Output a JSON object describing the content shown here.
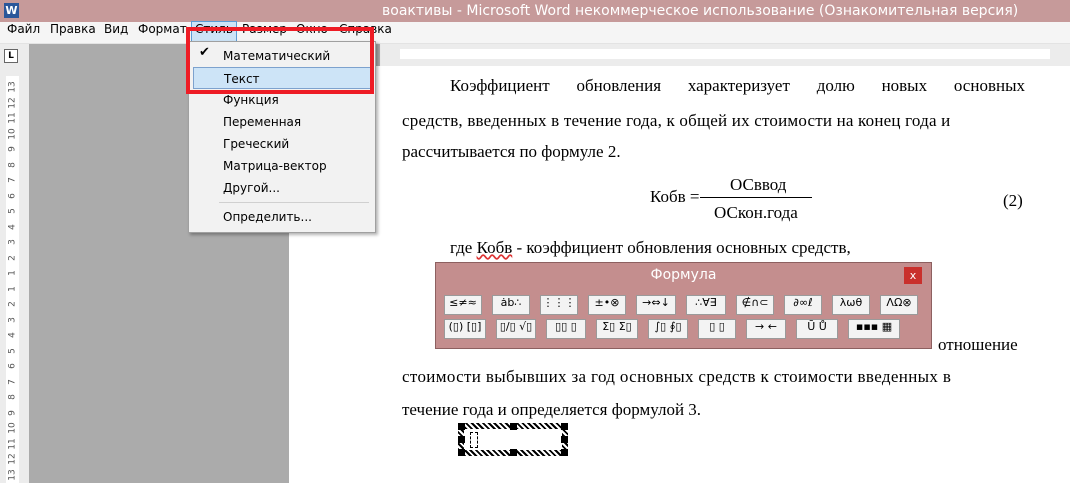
{
  "window": {
    "app_icon": "W",
    "title": "воактивы - Microsoft Word некоммерческое использование (Ознакомительная версия)"
  },
  "menubar": {
    "items": [
      {
        "label": "Файл"
      },
      {
        "label": "Правка"
      },
      {
        "label": "Вид"
      },
      {
        "label": "Формат"
      },
      {
        "label": "Стиль",
        "active": true
      },
      {
        "label": "Размер"
      },
      {
        "label": "Окно"
      },
      {
        "label": "Справка"
      }
    ]
  },
  "ruler": {
    "tab_marker": "L",
    "vertical_numbers": [
      "13",
      "12",
      "11",
      "10",
      "9",
      "8",
      "7",
      "6",
      "5",
      "4",
      "3",
      "2",
      "1",
      "1",
      "2",
      "3",
      "4",
      "5",
      "6",
      "7",
      "8",
      "9",
      "10",
      "11",
      "12",
      "13"
    ]
  },
  "style_menu": {
    "items": [
      {
        "label": "Математический",
        "checked": true
      },
      {
        "label": "Текст",
        "highlighted": true
      },
      {
        "label": "Функция"
      },
      {
        "label": "Переменная"
      },
      {
        "label": "Греческий"
      },
      {
        "label": "Матрица-вектор"
      },
      {
        "label": "Другой..."
      },
      {
        "label": "Определить..."
      }
    ],
    "check_icon": "check-icon"
  },
  "document": {
    "para1_line1_words": [
      "Коэффициент",
      "обновления",
      "характеризует",
      "долю",
      "новых",
      "основных"
    ],
    "para1_line2": "средств, введенных в течение года, к общей их стоимости на конец года и",
    "para1_line3": "рассчитывается по формуле 2.",
    "formula": {
      "lhs": "Кобв =",
      "numerator": "ОСввод",
      "denominator": "ОСкон.года",
      "number": "(2)"
    },
    "where_line_prefix": "где ",
    "where_word": "Кобв",
    "where_line_suffix": " - коэффициент обновления основных средств,",
    "para2_line1_partial": "отношение",
    "para2_line2": "стоимости выбывших за год основных средств к стоимости введенных в",
    "para2_line3": "течение года и определяется формулой 3."
  },
  "formula_toolbar": {
    "title": "Формула",
    "close_label": "x",
    "row1": [
      "≤≠≈",
      "ȧb∴",
      "⋮⋮⋮",
      "±•⊗",
      "→⇔↓",
      "∴∀∃",
      "∉∩⊂",
      "∂∞ℓ",
      "λωθ",
      "ΛΩ⊗"
    ],
    "row2": [
      "(▯) [▯]",
      "▯/▯ √▯",
      "▯▯ ▯",
      "Σ▯ Σ▯",
      "∫▯ ∮▯",
      "▯ ▯",
      "→ ←",
      "Ū Ů",
      "▪▪▪ ▦"
    ]
  },
  "colors": {
    "titlebar": "#c69a9a",
    "menu_highlight": "#cde4f7",
    "annotation_red": "#ee1c25",
    "formula_window": "#c48e8e"
  }
}
